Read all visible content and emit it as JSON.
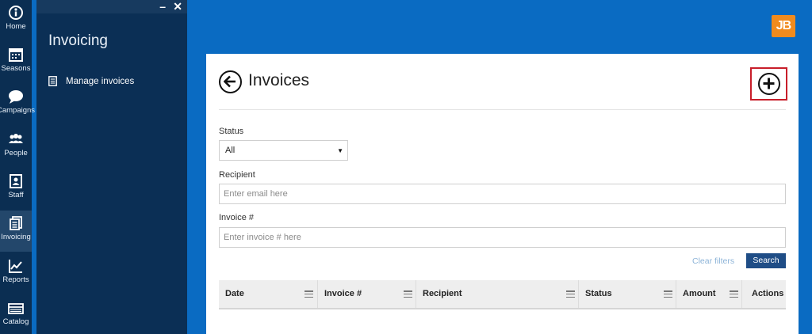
{
  "rail": {
    "items": [
      {
        "label": "Home",
        "icon": "home-info-icon"
      },
      {
        "label": "Seasons",
        "icon": "calendar-icon"
      },
      {
        "label": "Campaigns",
        "icon": "chat-bubble-icon"
      },
      {
        "label": "People",
        "icon": "people-icon"
      },
      {
        "label": "Staff",
        "icon": "staff-badge-icon"
      },
      {
        "label": "Invoicing",
        "icon": "invoice-icon"
      },
      {
        "label": "Reports",
        "icon": "chart-icon"
      },
      {
        "label": "Catalog",
        "icon": "catalog-icon"
      }
    ],
    "active": "Invoicing"
  },
  "panel": {
    "title": "Invoicing",
    "minimize_glyph": "–",
    "close_glyph": "✕",
    "links": [
      {
        "label": "Manage invoices",
        "icon": "document-icon"
      }
    ]
  },
  "brand": {
    "logo_text": "JB",
    "color": "#f08b1e"
  },
  "page": {
    "title": "Invoices",
    "back_icon": "arrow-left-circle-icon",
    "add_icon": "plus-circle-icon"
  },
  "filters": {
    "status": {
      "label": "Status",
      "value": "All"
    },
    "recipient": {
      "label": "Recipient",
      "placeholder": "Enter email here"
    },
    "invoice": {
      "label": "Invoice #",
      "placeholder": "Enter invoice # here"
    },
    "clear_label": "Clear filters",
    "search_label": "Search"
  },
  "table": {
    "columns": [
      "Date",
      "Invoice #",
      "Recipient",
      "Status",
      "Amount",
      "Actions"
    ]
  },
  "colors": {
    "background": "#0a6bc2",
    "rail": "#0b2e52",
    "panel": "#0b2f55",
    "primary_button": "#1f4d86",
    "highlight_border": "#c81e2a"
  }
}
